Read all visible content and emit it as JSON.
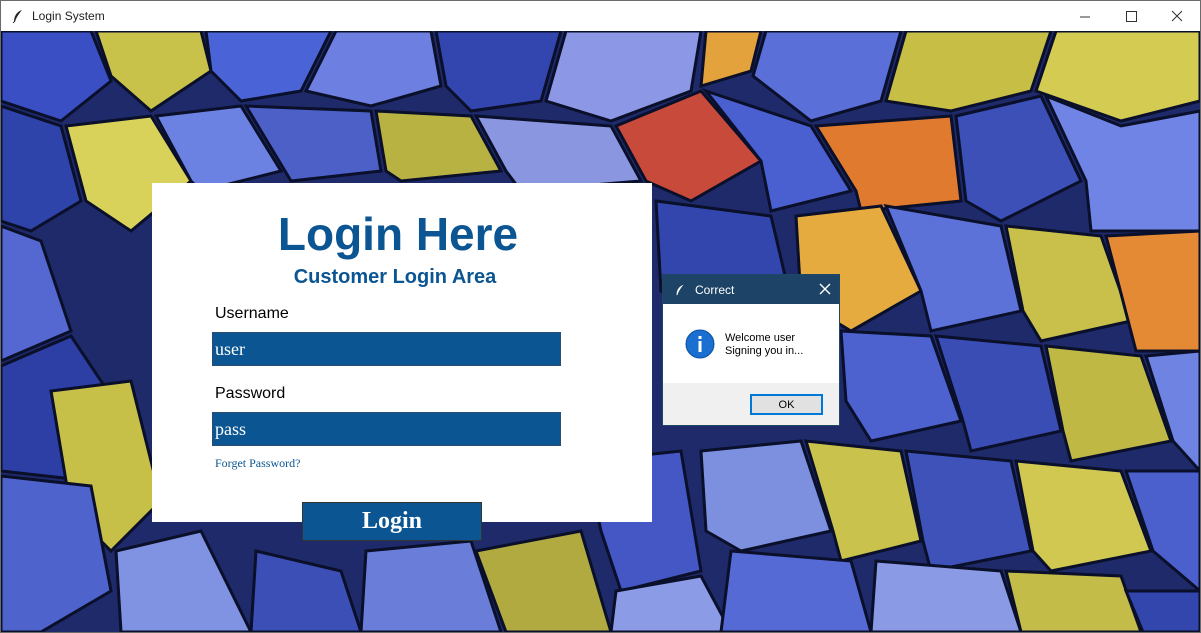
{
  "window": {
    "title": "Login System",
    "icon": "feather-icon"
  },
  "login_form": {
    "heading": "Login Here",
    "subheading": "Customer Login Area",
    "username_label": "Username",
    "username_value": "user",
    "password_label": "Password",
    "password_value": "pass",
    "forget_link": "Forget Password?",
    "login_button": "Login"
  },
  "dialog": {
    "title": "Correct",
    "message_line1": "Welcome user",
    "message_line2": "Signing you in...",
    "ok_button": "OK",
    "icon": "info-icon"
  },
  "colors": {
    "accent": "#0b5592",
    "dialog_title_bar": "#1d4466",
    "background_rocks": "#2c3f95"
  }
}
